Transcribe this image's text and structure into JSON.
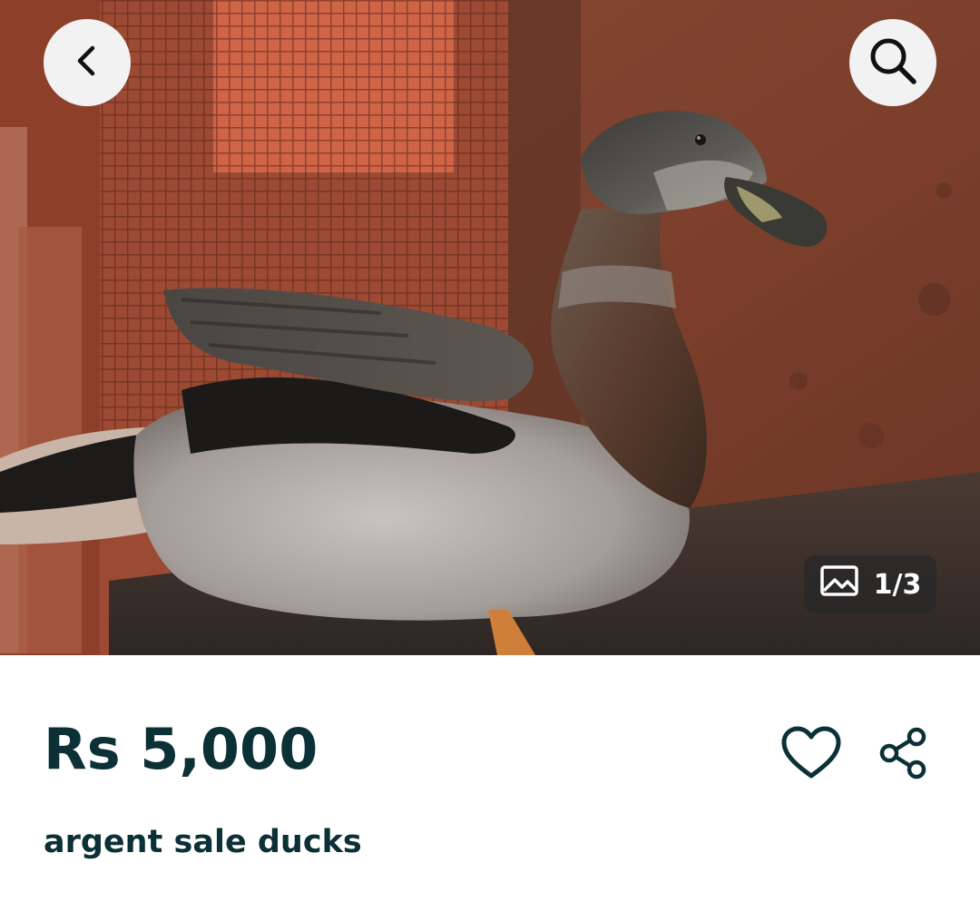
{
  "header": {
    "back_icon": "chevron-left-icon",
    "search_icon": "search-icon"
  },
  "gallery": {
    "counter_icon": "image-icon",
    "counter_text": "1/3"
  },
  "listing": {
    "price": "Rs 5,000",
    "title": "argent sale ducks",
    "favorite_icon": "heart-icon",
    "share_icon": "share-icon"
  },
  "colors": {
    "text_primary": "#0b3036",
    "button_bg": "#f2f2f2",
    "counter_bg": "#282828"
  }
}
